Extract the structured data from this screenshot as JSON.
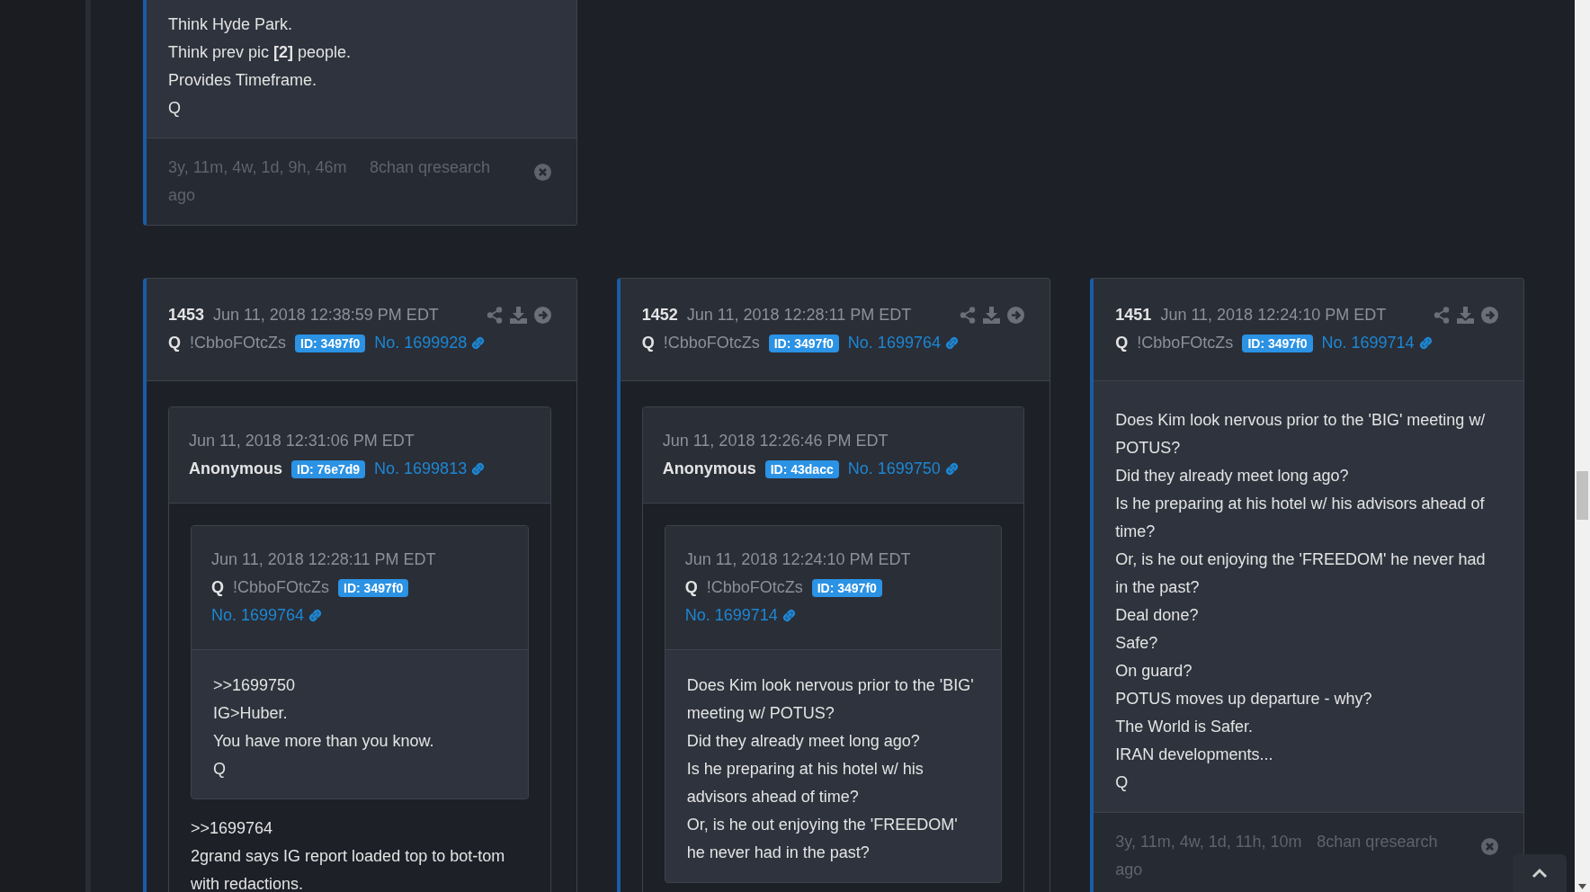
{
  "top_post": {
    "body": [
      "Think Hyde Park.",
      "Think prev pic **[2]** people.",
      "Provides Timeframe.",
      "Q"
    ],
    "footer": {
      "age": "3y, 11m, 4w, 1d, 9h, 46m ago",
      "source": "8chan qresearch"
    }
  },
  "posts": [
    {
      "number": "1453",
      "date": "Jun 11, 2018 12:38:59 PM EDT",
      "author": "Q",
      "tripcode": "!CbboFOtcZs",
      "id_badge": "ID: 3497f0",
      "post_no": "No. 1699928",
      "quote": {
        "date": "Jun 11, 2018 12:31:06 PM EDT",
        "author": "Anonymous",
        "id_badge": "ID: 76e7d9",
        "post_no": "No. 1699813",
        "quote": {
          "date": "Jun 11, 2018 12:28:11 PM EDT",
          "author": "Q",
          "tripcode": "!CbboFOtcZs",
          "id_badge": "ID: 3497f0",
          "post_no": "No. 1699764",
          "body": [
            ">>1699750",
            "IG>Huber.",
            "You have more than you know.",
            "Q"
          ]
        },
        "body": [
          ">>1699764",
          "2grand says IG report loaded top to bot-tom with redactions."
        ]
      }
    },
    {
      "number": "1452",
      "date": "Jun 11, 2018 12:28:11 PM EDT",
      "author": "Q",
      "tripcode": "!CbboFOtcZs",
      "id_badge": "ID: 3497f0",
      "post_no": "No. 1699764",
      "quote": {
        "date": "Jun 11, 2018 12:26:46 PM EDT",
        "author": "Anonymous",
        "id_badge": "ID: 43dacc",
        "post_no": "No. 1699750",
        "quote": {
          "date": "Jun 11, 2018 12:24:10 PM EDT",
          "author": "Q",
          "tripcode": "!CbboFOtcZs",
          "id_badge": "ID: 3497f0",
          "post_no": "No. 1699714",
          "body": [
            "Does Kim look nervous prior to the 'BIG' meeting w/ POTUS?",
            "Did they already meet long ago?",
            "Is he preparing at his hotel w/ his advisors ahead of time?",
            "Or, is he out enjoying the 'FREEDOM' he never had in the past?"
          ]
        }
      }
    },
    {
      "number": "1451",
      "date": "Jun 11, 2018 12:24:10 PM EDT",
      "author": "Q",
      "tripcode": "!CbboFOtcZs",
      "id_badge": "ID: 3497f0",
      "post_no": "No. 1699714",
      "body": [
        "Does Kim look nervous prior to the 'BIG' meeting w/ POTUS?",
        "Did they already meet long ago?",
        "Is he preparing at his hotel w/ his advisors ahead of time?",
        "Or, is he out enjoying the 'FREEDOM' he never had in the past?",
        "Deal done?",
        "Safe?",
        "On guard?",
        "POTUS moves up departure - why?",
        "The World is Safer.",
        "IRAN developments...",
        "Q"
      ],
      "footer": {
        "age": "3y, 11m, 4w, 1d, 11h, 10m ago",
        "source": "8chan qresearch"
      }
    }
  ]
}
